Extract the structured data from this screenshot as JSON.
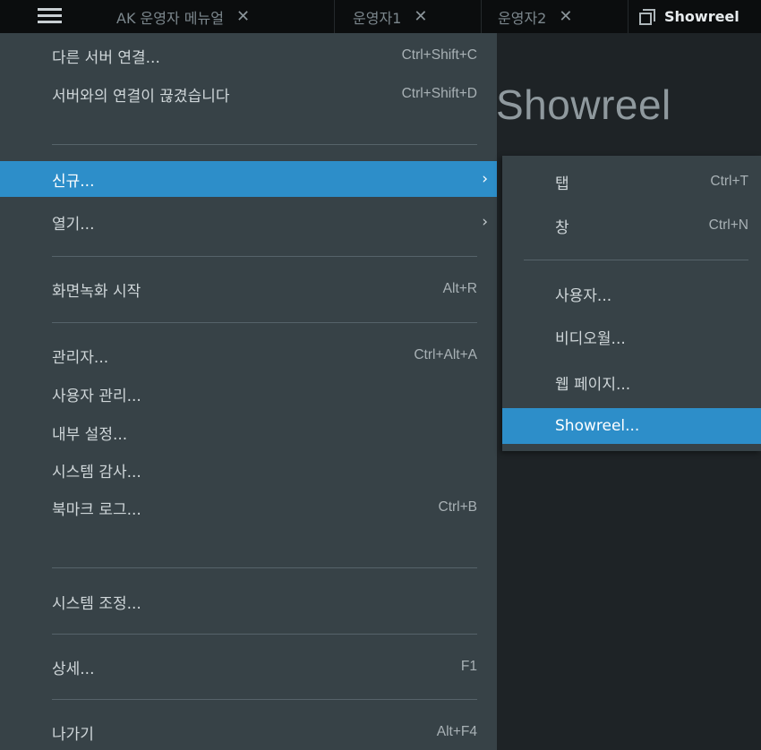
{
  "tabs": [
    {
      "label": "AK 운영자 메뉴얼",
      "close": "✕"
    },
    {
      "label": "운영자1",
      "close": "✕"
    },
    {
      "label": "운영자2",
      "close": "✕"
    },
    {
      "label": "Showreel",
      "icon": "layout-icon"
    }
  ],
  "stage": {
    "title": "Showreel"
  },
  "main_menu": {
    "connect_other": {
      "label": "다른 서버 연결...",
      "shortcut": "Ctrl+Shift+C"
    },
    "disconnected": {
      "label": "서버와의 연결이 끊겼습니다",
      "shortcut": "Ctrl+Shift+D"
    },
    "new": {
      "label": "신규...",
      "arrow": "›"
    },
    "open": {
      "label": "열기...",
      "arrow": "›"
    },
    "screen_record": {
      "label": "화면녹화 시작",
      "shortcut": "Alt+R"
    },
    "admin": {
      "label": "관리자...",
      "shortcut": "Ctrl+Alt+A"
    },
    "user_mgmt": {
      "label": "사용자 관리..."
    },
    "local_settings": {
      "label": "내부 설정..."
    },
    "system_audit": {
      "label": "시스템 감사..."
    },
    "bookmark_log": {
      "label": "북마크 로그...",
      "shortcut": "Ctrl+B"
    },
    "system_admin": {
      "label": "시스템 조정..."
    },
    "about": {
      "label": "상세...",
      "shortcut": "F1"
    },
    "exit": {
      "label": "나가기",
      "shortcut": "Alt+F4"
    }
  },
  "submenu_new": {
    "tab": {
      "label": "탭",
      "shortcut": "Ctrl+T"
    },
    "window": {
      "label": "창",
      "shortcut": "Ctrl+N"
    },
    "user": {
      "label": "사용자..."
    },
    "videowall": {
      "label": "비디오월..."
    },
    "webpage": {
      "label": "웹 페이지..."
    },
    "showreel": {
      "label": "Showreel..."
    }
  },
  "colors": {
    "menu_bg": "#374247",
    "highlight": "#2d8ec9",
    "topbar_bg": "#0b0d0e"
  }
}
